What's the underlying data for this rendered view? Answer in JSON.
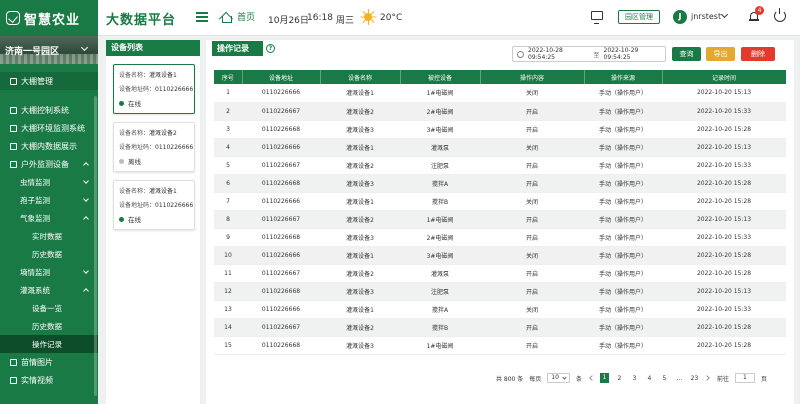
{
  "header": {
    "logo_text": "智慧农业",
    "platform_title": "大数据平台",
    "home_label": "首页",
    "date": "10月26日",
    "time": "16:18",
    "weekday": "周三",
    "temperature": "20°C",
    "park_button": "园区管理",
    "avatar_initial": "J",
    "username": "jnrstest",
    "notification_count": "4"
  },
  "sidebar": {
    "park_name": "济南一号园区",
    "items": [
      {
        "label": "大棚管理"
      },
      {
        "label": "大棚控制系统"
      },
      {
        "label": "大棚环境监测系统"
      },
      {
        "label": "大棚内数据展示"
      },
      {
        "label": "户外监测设备"
      },
      {
        "label": "虫情监测"
      },
      {
        "label": "孢子监测"
      },
      {
        "label": "气象监测"
      },
      {
        "label": "实时数据"
      },
      {
        "label": "历史数据"
      },
      {
        "label": "墒情监测"
      },
      {
        "label": "灌溉系统"
      },
      {
        "label": "设备一览"
      },
      {
        "label": "历史数据"
      },
      {
        "label": "操作记录"
      },
      {
        "label": "苗情图片"
      },
      {
        "label": "实情视频"
      }
    ]
  },
  "device_panel": {
    "title": "设备列表",
    "name_key": "设备名称：",
    "addr_key": "设备地址码：",
    "devices": [
      {
        "name": "灌溉设备1",
        "address": "0110226666",
        "status": "在线"
      },
      {
        "name": "灌溉设备2",
        "address": "0110226666",
        "status": "离线"
      },
      {
        "name": "灌溉设备1",
        "address": "0110226666",
        "status": "在线"
      }
    ]
  },
  "main": {
    "tab_title": "操作记录",
    "help": "?",
    "date_start": "2022-10-28 09:54:25",
    "date_sep": "至",
    "date_end": "2022-10-29 09:54:25",
    "search_label": "查询",
    "export_label": "导出",
    "delete_label": "删除",
    "columns": [
      "序号",
      "设备地址",
      "设备名称",
      "被控设备",
      "操作内容",
      "操作来源",
      "记录时间"
    ],
    "rows": [
      [
        "1",
        "0110226666",
        "灌溉设备1",
        "1#电磁阀",
        "关闭",
        "手动（操作用户）",
        "2022-10-20 15:13"
      ],
      [
        "2",
        "0110226667",
        "灌溉设备2",
        "2#电磁阀",
        "开启",
        "手动（操作用户）",
        "2022-10-20 15:33"
      ],
      [
        "3",
        "0110226668",
        "灌溉设备3",
        "3#电磁阀",
        "开启",
        "手动（操作用户）",
        "2022-10-20 15:28"
      ],
      [
        "4",
        "0110226666",
        "灌溉设备1",
        "灌溉泵",
        "关闭",
        "手动（操作用户）",
        "2022-10-20 15:13"
      ],
      [
        "5",
        "0110226667",
        "灌溉设备2",
        "注肥泵",
        "开启",
        "手动（操作用户）",
        "2022-10-20 15:33"
      ],
      [
        "6",
        "0110226668",
        "灌溉设备3",
        "搅拌A",
        "开启",
        "手动（操作用户）",
        "2022-10-20 15:28"
      ],
      [
        "7",
        "0110226666",
        "灌溉设备1",
        "搅拌B",
        "关闭",
        "手动（操作用户）",
        "2022-10-20 15:28"
      ],
      [
        "8",
        "0110226667",
        "灌溉设备2",
        "1#电磁阀",
        "开启",
        "手动（操作用户）",
        "2022-10-20 15:13"
      ],
      [
        "9",
        "0110226668",
        "灌溉设备3",
        "2#电磁阀",
        "开启",
        "手动（操作用户）",
        "2022-10-20 15:33"
      ],
      [
        "10",
        "0110226666",
        "灌溉设备1",
        "3#电磁阀",
        "关闭",
        "手动（操作用户）",
        "2022-10-20 15:28"
      ],
      [
        "11",
        "0110226667",
        "灌溉设备2",
        "灌溉泵",
        "开启",
        "手动（操作用户）",
        "2022-10-20 15:28"
      ],
      [
        "12",
        "0110226668",
        "灌溉设备3",
        "注肥泵",
        "开启",
        "手动（操作用户）",
        "2022-10-20 15:13"
      ],
      [
        "13",
        "0110226666",
        "灌溉设备1",
        "搅拌A",
        "关闭",
        "手动（操作用户）",
        "2022-10-20 15:33"
      ],
      [
        "14",
        "0110226667",
        "灌溉设备2",
        "搅拌B",
        "开启",
        "手动（操作用户）",
        "2022-10-20 15:28"
      ],
      [
        "15",
        "0110226668",
        "灌溉设备3",
        "1#电磁阀",
        "开启",
        "手动（操作用户）",
        "2022-10-20 15:28"
      ]
    ],
    "pagination": {
      "total": "共 800 条",
      "per_page_label": "每页",
      "page_size": "10",
      "per_page_unit": "条",
      "pages": [
        "1",
        "2",
        "3",
        "4",
        "5",
        "…",
        "23"
      ],
      "goto_label": "前往",
      "goto_value": "1",
      "goto_unit": "页"
    }
  },
  "colors": {
    "primary": "#1a7a45",
    "export": "#e5a82e",
    "danger": "#e23b2e",
    "online": "#1a7a45",
    "offline": "#bbbbbb"
  }
}
